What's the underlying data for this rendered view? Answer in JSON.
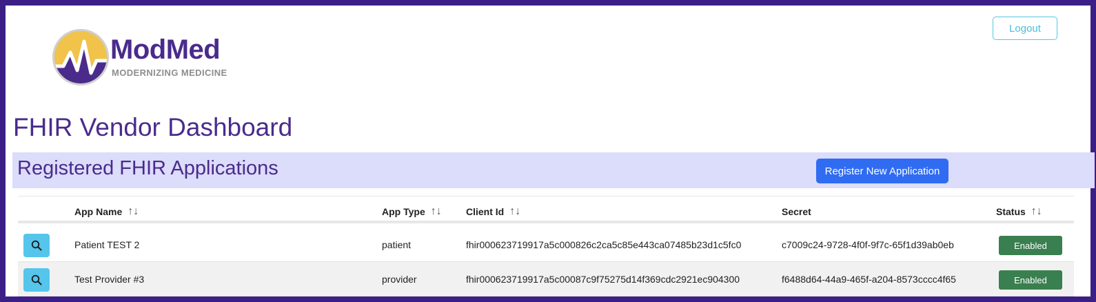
{
  "header": {
    "logo": {
      "name": "ModMed",
      "tagline": "MODERNIZING MEDICINE"
    },
    "logout_label": "Logout"
  },
  "page": {
    "title": "FHIR Vendor Dashboard",
    "section_title": "Registered FHIR Applications",
    "register_label": "Register New Application"
  },
  "table": {
    "columns": [
      "App Name",
      "App Type",
      "Client Id",
      "Secret",
      "Status"
    ],
    "sort_icon": "↑↓",
    "rows": [
      {
        "app_name": "Patient TEST 2",
        "app_type": "patient",
        "client_id": "fhir000623719917a5c000826c2ca5c85e443ca07485b23d1c5fc0",
        "secret": "c7009c24-9728-4f0f-9f7c-65f1d39ab0eb",
        "status": "Enabled"
      },
      {
        "app_name": "Test Provider #3",
        "app_type": "provider",
        "client_id": "fhir000623719917a5c00087c9f75275d14f369cdc2921ec904300",
        "secret": "f6488d64-44a9-465f-a204-8573cccc4f65",
        "status": "Enabled"
      }
    ]
  },
  "colors": {
    "brand_purple": "#4a2b8c",
    "frame_border": "#3b1f86",
    "section_band": "#dcdcfb",
    "primary_button": "#2f6cf2",
    "view_button": "#55c5eb",
    "status_enabled": "#3a7f4f",
    "logout_border": "#56c7e3"
  },
  "icons": {
    "view": "search-icon",
    "sort": "sort-icon"
  }
}
